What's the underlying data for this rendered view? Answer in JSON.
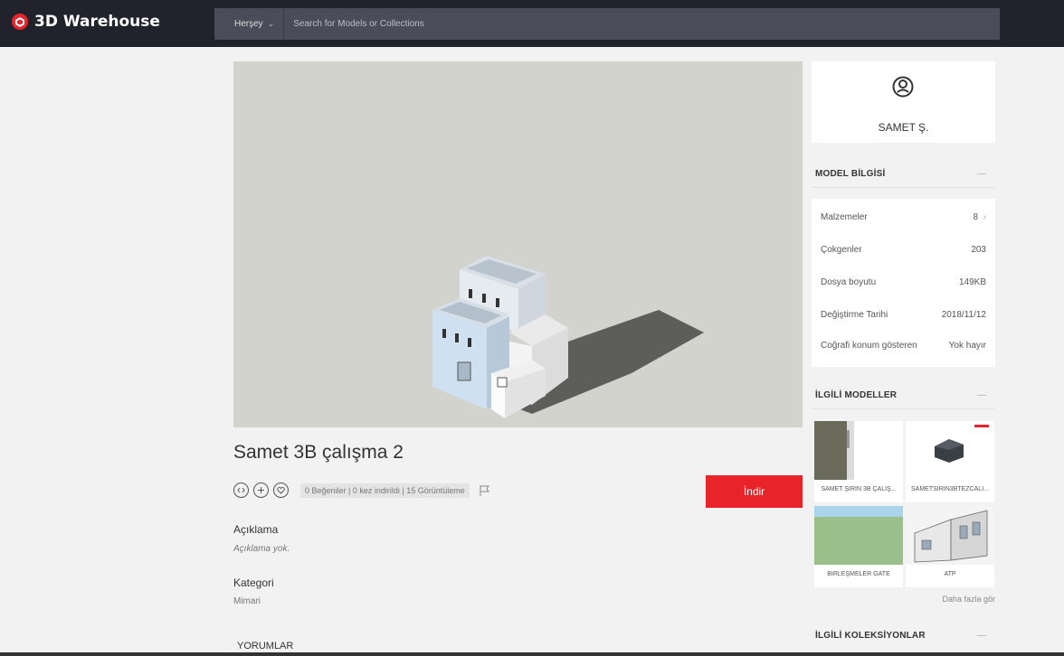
{
  "header": {
    "app_name": "3D Warehouse",
    "scope_label": "Herşey",
    "search_placeholder": "Search for Models or Collections",
    "accent": "#e8232a"
  },
  "model": {
    "title": "Samet 3B çalışma 2",
    "stats": "0 Beğeniler | 0 kez indirildi | 15 Görüntüleme",
    "download_label": "İndir",
    "description_label": "Açıklama",
    "description_value": "Açıklama yok.",
    "category_label": "Kategori",
    "category_value": "Mimari",
    "comments_label": "YORUMLAR",
    "action_icons": [
      "embed-icon",
      "add-icon",
      "like-icon",
      "flag-icon"
    ]
  },
  "author": {
    "name": "SAMET Ş.",
    "icon": "user-icon"
  },
  "model_info": {
    "heading": "MODEL BİLGİSİ",
    "collapse": "—",
    "rows": [
      {
        "label": "Malzemeler",
        "value": "8"
      },
      {
        "label": "Çokgenler",
        "value": "203"
      },
      {
        "label": "Dosya boyutu",
        "value": "149KB"
      },
      {
        "label": "Değiştirme Tarihi",
        "value": "2018/11/12"
      },
      {
        "label": "Coğrafi konum gösteren",
        "value": "Yok hayır"
      }
    ]
  },
  "related_models": {
    "heading": "İLGİLİ MODELLER",
    "collapse": "—",
    "items": [
      {
        "caption": "SAMET ŞİRİN 3B ÇALIŞ..."
      },
      {
        "caption": "SAMETSIRIN3BTEZCALI..."
      },
      {
        "caption": "BİRLEŞMELER GATE"
      },
      {
        "caption": "ATP"
      }
    ],
    "more_label": "Daha fazla gör"
  },
  "related_collections": {
    "heading": "İLGİLİ KOLEKSİYONLAR",
    "collapse": "—"
  }
}
